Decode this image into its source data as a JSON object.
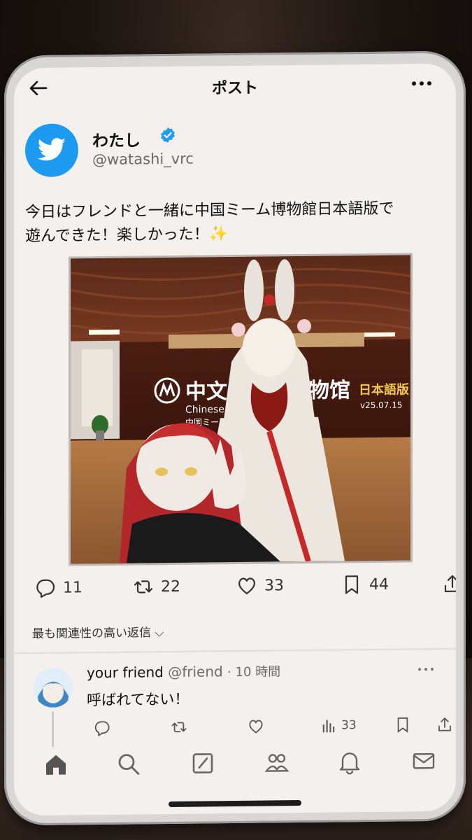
{
  "header": {
    "title": "ポスト"
  },
  "author": {
    "name": "わたし",
    "handle": "@watashi_vrc",
    "verified": true
  },
  "post": {
    "text_line1": "今日はフレンドと一緒に中国ミーム博物館日本語版で",
    "text_line2": "遊んできた！楽しかった！✨",
    "media": {
      "title_main": "中文",
      "title_end": "物馆",
      "badge": "日本語版",
      "subtitle": "Chinese m",
      "subtitle_jp": "中国ミーム博",
      "version": "v25.07.15"
    }
  },
  "actions": {
    "replies": "11",
    "reposts": "22",
    "likes": "33",
    "bookmarks": "44"
  },
  "replies_sort": "最も関連性の高い返信",
  "reply": {
    "name": "your friend",
    "handle": "@friend",
    "time": "· 10 時間",
    "text": "呼ばれてない！",
    "views": "33"
  },
  "colors": {
    "accent": "#1d9bf0",
    "text": "#111111",
    "muted": "#6b6b6b"
  }
}
